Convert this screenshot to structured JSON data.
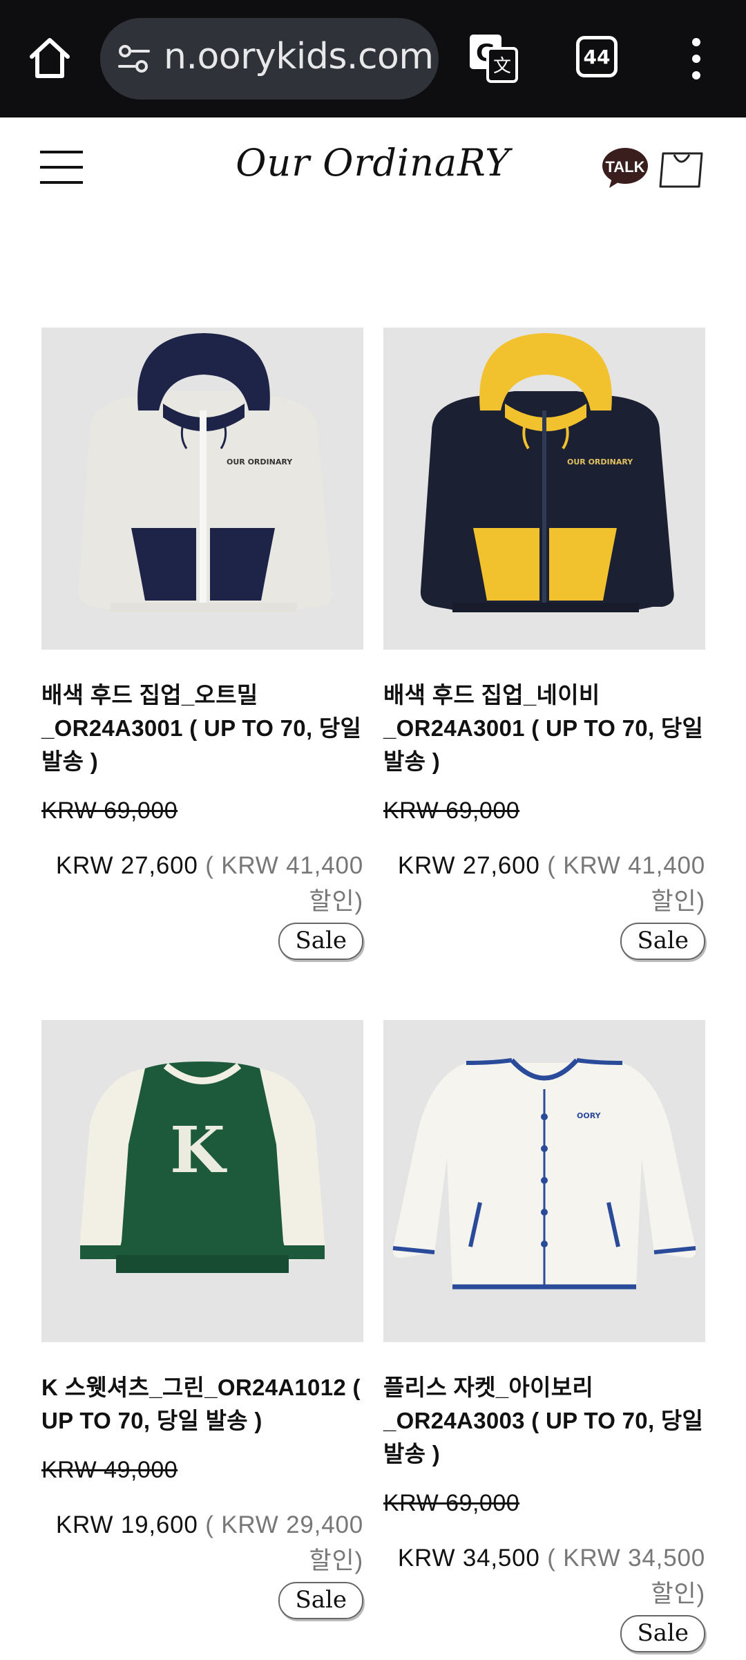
{
  "browser": {
    "url": "n.oorykids.com",
    "tab_count": "44"
  },
  "site": {
    "logo": "Our OrdinaRY",
    "talk_label": "TALK"
  },
  "products": [
    {
      "name": "배색 후드 집업_오트밀_OR24A3001 ( UP TO 70, 당일 발송 )",
      "original_price": "KRW 69,000",
      "price": "KRW 27,600",
      "discount": "( KRW 41,400 할인)",
      "badge": "Sale",
      "image_brand": "OUR ORDINARY"
    },
    {
      "name": "배색 후드 집업_네이비_OR24A3001 ( UP TO 70, 당일 발송 )",
      "original_price": "KRW 69,000",
      "price": "KRW 27,600",
      "discount": "( KRW 41,400 할인)",
      "badge": "Sale",
      "image_brand": "OUR ORDINARY"
    },
    {
      "name": "K 스웻셔츠_그린_OR24A1012 ( UP TO 70, 당일 발송 )",
      "original_price": "KRW 49,000",
      "price": "KRW 19,600",
      "discount": "( KRW 29,400 할인)",
      "badge": "Sale",
      "image_letter": "K"
    },
    {
      "name": "플리스 자켓_아이보리_OR24A3003 ( UP TO 70, 당일 발송 )",
      "original_price": "KRW 69,000",
      "price": "KRW 34,500",
      "discount": "( KRW 34,500 할인)",
      "badge": "Sale",
      "image_brand": "OORY"
    }
  ],
  "colors": {
    "browser_bg": "#0e0e10",
    "url_pill": "#2f3238",
    "thumb_bg": "#e4e4e4",
    "discount_text": "#777777",
    "talk_bubble": "#3a1d1d"
  }
}
